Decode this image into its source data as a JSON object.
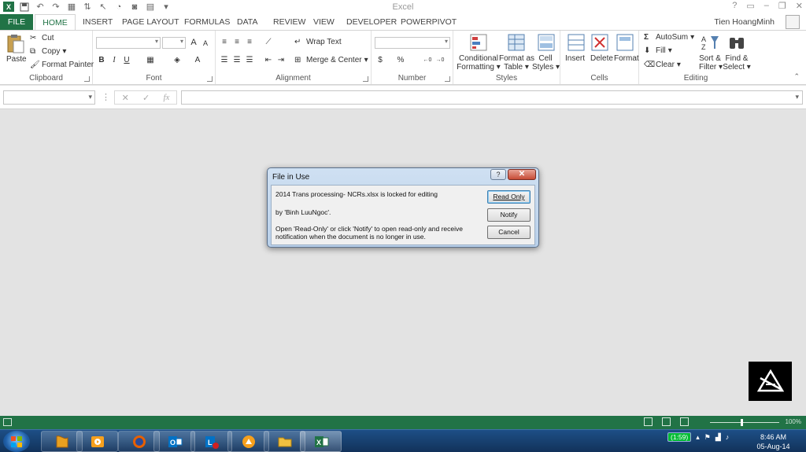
{
  "app": {
    "title": "Excel",
    "user": "Tien HoangMinh",
    "window_controls": [
      "?",
      "▭",
      "–",
      "❐",
      "✕"
    ]
  },
  "ribbon_tabs": [
    "FILE",
    "HOME",
    "INSERT",
    "PAGE LAYOUT",
    "FORMULAS",
    "DATA",
    "REVIEW",
    "VIEW",
    "DEVELOPER",
    "POWERPIVOT"
  ],
  "ribbon": {
    "clipboard": {
      "label": "Clipboard",
      "paste": "Paste",
      "cut": "Cut",
      "copy": "Copy",
      "format_painter": "Format Painter"
    },
    "font": {
      "label": "Font",
      "bold": "B",
      "italic": "I",
      "underline": "U",
      "grow": "A",
      "shrink": "A"
    },
    "alignment": {
      "label": "Alignment",
      "wrap_text": "Wrap Text",
      "merge_center": "Merge & Center"
    },
    "number": {
      "label": "Number",
      "currency": "$",
      "percent": "%",
      "inc_decimal": ",0 .00",
      "dec_decimal": ".00 →.0"
    },
    "styles": {
      "label": "Styles",
      "cond_format_1": "Conditional",
      "cond_format_2": "Formatting",
      "format_table_1": "Format as",
      "format_table_2": "Table",
      "cell_styles_1": "Cell",
      "cell_styles_2": "Styles"
    },
    "cells": {
      "label": "Cells",
      "insert": "Insert",
      "delete": "Delete",
      "format": "Format"
    },
    "editing": {
      "label": "Editing",
      "autosum": "AutoSum",
      "fill": "Fill",
      "clear": "Clear",
      "sort_1": "Sort &",
      "sort_2": "Filter",
      "find_1": "Find &",
      "find_2": "Select"
    }
  },
  "formula_bar": {
    "name_box": "",
    "cancel": "✕",
    "enter": "✓",
    "fx": "fx",
    "content": ""
  },
  "dialog": {
    "title": "File in Use",
    "help": "?",
    "close": "✕",
    "line1": "2014 Trans processing- NCRs.xlsx is locked for editing",
    "line2": "by 'Binh LuuNgoc'.",
    "line3": "Open 'Read-Only' or click 'Notify' to open read-only and receive",
    "line4": "notification when the document is no longer in use.",
    "buttons": {
      "read_only": "Read Only",
      "notify": "Notify",
      "cancel": "Cancel"
    }
  },
  "status_bar": {
    "zoom": "100%"
  },
  "taskbar": {
    "apps": [
      "file-manager",
      "media-player",
      "firefox",
      "outlook",
      "lync",
      "app-circle",
      "folder",
      "excel"
    ],
    "battery": "(1:59)",
    "time": "8:46 AM",
    "date": "05-Aug-14"
  },
  "colors": {
    "excel_green": "#217346",
    "workspace_gray": "#e3e3e3",
    "taskbar_blue": "#1d4f86"
  }
}
